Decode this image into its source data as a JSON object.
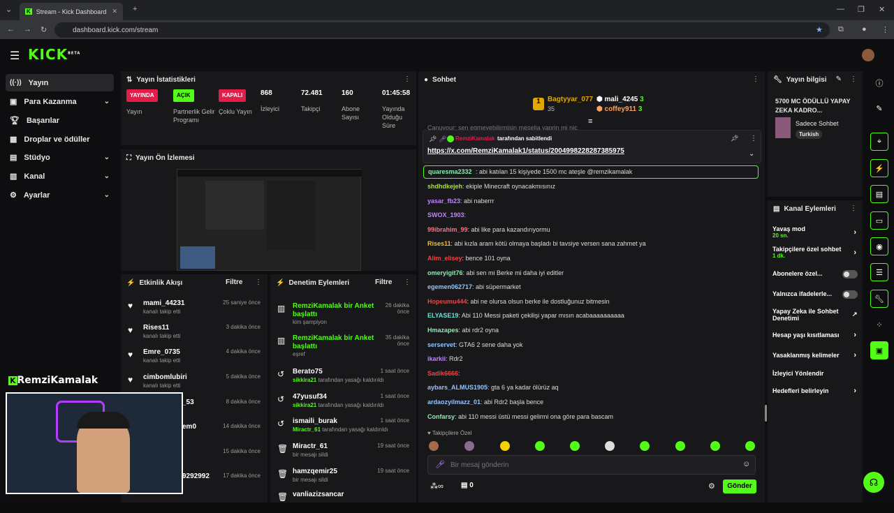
{
  "browser": {
    "tab_title": "Stream - Kick Dashboard",
    "url": "dashboard.kick.com/stream"
  },
  "app": {
    "logo": "KICK",
    "logo_tag": "BETA",
    "accent": "#53fc18"
  },
  "sidebar": {
    "items": [
      {
        "label": "Yayın",
        "icon": "broadcast-icon"
      },
      {
        "label": "Para Kazanma",
        "icon": "dollar-icon"
      },
      {
        "label": "Başarılar",
        "icon": "trophy-icon"
      },
      {
        "label": "Droplar ve ödüller",
        "icon": "gift-icon"
      },
      {
        "label": "Stüdyo",
        "icon": "studio-icon"
      },
      {
        "label": "Kanal",
        "icon": "channel-icon"
      },
      {
        "label": "Ayarlar",
        "icon": "gear-icon"
      }
    ],
    "overlay_channel": "RemziKamalak"
  },
  "stats": {
    "title": "Yayın İstatistikleri",
    "items": [
      {
        "badge": "YAYINDA",
        "label": "Yayın"
      },
      {
        "badge": "AÇIK",
        "label": "Partnerlik Gelir Programı"
      },
      {
        "badge": "KAPALI",
        "label": "Çoklu Yayın"
      },
      {
        "value": "868",
        "label": "İzleyici"
      },
      {
        "value": "72.481",
        "label": "Takipçi"
      },
      {
        "value": "160",
        "label": "Abone Sayısı"
      },
      {
        "value": "01:45:58",
        "label": "Yayında Olduğu Süre"
      }
    ]
  },
  "preview": {
    "title": "Yayın Ön İzlemesi"
  },
  "activity": {
    "title": "Etkinlik Akışı",
    "filter": "Filtre",
    "rows": [
      {
        "name": "mami_44231",
        "action": "kanalı takip etti",
        "time": "25 saniye önce"
      },
      {
        "name": "Rises11",
        "action": "kanalı takip etti",
        "time": "3 dakika önce"
      },
      {
        "name": "Emre_0735",
        "action": "kanalı takip etti",
        "time": "4 dakika önce"
      },
      {
        "name": "cimbomlubiri",
        "action": "kanalı takip etti",
        "time": "5 dakika önce"
      },
      {
        "name": "_53",
        "action": "",
        "time": "8 dakika önce"
      },
      {
        "name": "em0",
        "action": "",
        "time": "14 dakika önce"
      },
      {
        "name": "",
        "action": "",
        "time": "15 dakika önce"
      },
      {
        "name": "9292992",
        "action": "",
        "time": "17 dakika önce"
      }
    ]
  },
  "moderation": {
    "title": "Denetim Eylemleri",
    "filter": "Filtre",
    "rows": [
      {
        "name": "RemziKamalak bir Anket başlattı",
        "sub": "kim şampiyon",
        "time": "26 dakika önce",
        "icon": "poll-icon"
      },
      {
        "name": "RemziKamalak bir Anket başlattı",
        "sub": "eşref",
        "time": "35 dakika önce",
        "icon": "poll-icon"
      },
      {
        "name": "Berato75",
        "mod": "sikkira21",
        "sub": "tarafından yasağı kaldırıldı",
        "time": "1 saat önce",
        "icon": "undo-icon"
      },
      {
        "name": "47yusuf34",
        "mod": "sikkira21",
        "sub": "tarafından yasağı kaldırıldı",
        "time": "1 saat önce",
        "icon": "undo-icon"
      },
      {
        "name": "ismaili_burak",
        "mod": "Miractr_61",
        "sub": "tarafından yasağı kaldırıldı",
        "time": "1 saat önce",
        "icon": "undo-icon"
      },
      {
        "name": "Miractr_61",
        "sub": "bir mesajı sildi",
        "time": "19 saat önce",
        "icon": "trash-icon"
      },
      {
        "name": "hamzqemir25",
        "sub": "bir mesajı sildi",
        "time": "19 saat önce",
        "icon": "trash-icon"
      },
      {
        "name": "vanliazizsancar",
        "sub": "",
        "time": "",
        "icon": "trash-icon"
      }
    ]
  },
  "chat": {
    "title": "Sohbet",
    "leaders": [
      {
        "name": "Bagtyyar_077",
        "count": "35"
      },
      {
        "name": "mali_4245",
        "count": "3"
      },
      {
        "name": "coffey911",
        "count": "3"
      }
    ],
    "faded_line": "Canuyour: sen egmeyebilirmisin meselia yaprin mi nic",
    "pinned_by": "RemziKamalak",
    "pinned_suffix": "tarafından sabitlendi",
    "pinned_link": "https://x.com/RemziKamalak1/status/2004998228287385975",
    "highlight": {
      "user": "quaresma2332",
      "text": ": abi katılan 15 kişiyede 1500 mc ateşle @remzikamalak"
    },
    "messages": [
      {
        "user": "shdhdkejeh",
        "text": ": ekiple Minecraft oynacakmısınız",
        "color": "#a3e635"
      },
      {
        "user": "yasar_fb23",
        "text": ": abi naberrr",
        "color": "#c084fc"
      },
      {
        "user": "SWOX_1903",
        "text": ":",
        "color": "#c084fc"
      },
      {
        "user": "99ibrahim_99",
        "text": ": abi like para kazandırıyormu",
        "color": "#fb7185"
      },
      {
        "user": "Rises11",
        "text": ": abi kızla aram kötü olmaya başladı bi tavsiye versen sana zahmet ya",
        "color": "#fbbf24"
      },
      {
        "user": "Alim_elisey",
        "text": ": bence 101 oyna",
        "color": "#ef4444"
      },
      {
        "user": "omeryigit76",
        "text": ": abi sen mi Berke mi daha iyi editler",
        "color": "#86efac"
      },
      {
        "user": "egemen062717",
        "text": ": abi süpermarket",
        "color": "#93c5fd"
      },
      {
        "user": "Hopeumu444",
        "text": ": abi ne olursa olsun berke ile dostluğunuz bitmesin",
        "color": "#ef4444"
      },
      {
        "user": "ELYASE19",
        "text": ": Abi 110 Messi paketi çekilişi yapar mısın acabaaaaaaaaaa",
        "color": "#5eead4"
      },
      {
        "user": "Hmazapes",
        "text": ": abi rdr2 oyna",
        "color": "#86efac"
      },
      {
        "user": "serservet",
        "text": ": GTA6 2 sene daha yok",
        "color": "#93c5fd"
      },
      {
        "user": "ikarkii",
        "text": ": Rdr2",
        "color": "#c084fc"
      },
      {
        "user": "Sadik6666",
        "text": ":",
        "color": "#ef4444"
      },
      {
        "user": "aybars_ALMUS1905",
        "text": ": gta 6 ya kadar ölürüz aq",
        "color": "#93c5fd"
      },
      {
        "user": "ardaozyilmazz_01",
        "text": ": abi Rdr2 başla bence",
        "color": "#93c5fd"
      },
      {
        "user": "Confarsy",
        "text": ": abi 110 messi üstü messi gelirmi ona göre para bascam",
        "color": "#86efac"
      }
    ],
    "followers_only": "Takipçilere Özel",
    "input_placeholder": "Bir mesaj gönderin",
    "points": "0",
    "send": "Gönder"
  },
  "stream_info": {
    "title": "Yayın bilgisi",
    "stream_title": "5700 MC ÖDÜLLÜ YAPAY ZEKA KADRO...",
    "category": "Sadece Sohbet",
    "tag": "Turkish"
  },
  "channel_actions": {
    "title": "Kanal Eylemleri",
    "items": [
      {
        "label": "Yavaş mod",
        "sub": "20 sn.",
        "control": "arrow"
      },
      {
        "label": "Takipçilere özel sohbet",
        "sub": "1 dk.",
        "control": "arrow"
      },
      {
        "label": "Abonelere özel...",
        "sub": "",
        "control": "toggle"
      },
      {
        "label": "Yalnızca ifadelerle...",
        "sub": "",
        "control": "toggle"
      },
      {
        "label": "Yapay Zeka ile Sohbet Denetimi",
        "sub": "",
        "control": "external"
      },
      {
        "label": "Hesap yaşı kısıtlaması",
        "sub": "",
        "control": "arrow"
      },
      {
        "label": "Yasaklanmış kelimeler",
        "sub": "",
        "control": "arrow"
      },
      {
        "label": "İzleyici Yönlendir",
        "sub": "",
        "control": "none"
      },
      {
        "label": "Hedefleri belirleyin",
        "sub": "",
        "control": "arrow"
      }
    ]
  }
}
